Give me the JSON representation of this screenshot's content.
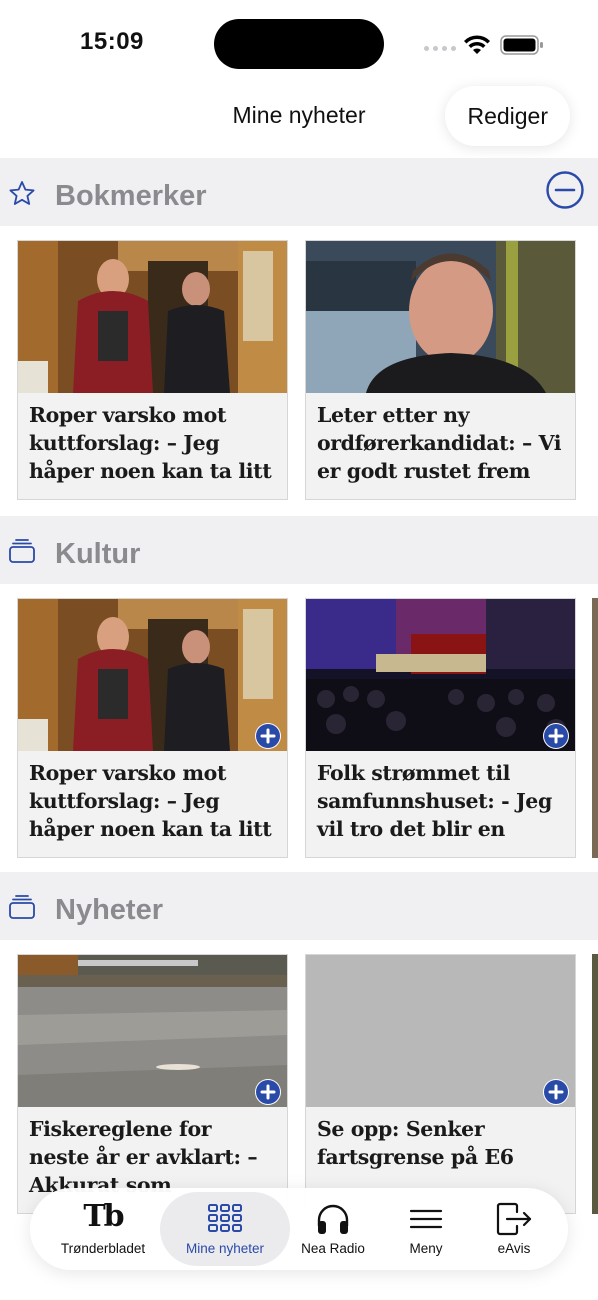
{
  "status_bar": {
    "time": "15:09"
  },
  "header": {
    "title": "Mine nyheter",
    "edit_label": "Rediger"
  },
  "sections": [
    {
      "title": "Bokmerker",
      "icon": "star-icon",
      "cards": [
        {
          "title": "Roper varsko mot kuttforslag: – Jeg håper noen kan ta litt",
          "image": "two-men-hallway-photo"
        },
        {
          "title": "Leter etter ny ordførerkandidat: – Vi er godt rustet frem",
          "image": "man-portrait-photo"
        }
      ]
    },
    {
      "title": "Kultur",
      "icon": "stack-icon",
      "cards": [
        {
          "title": "Roper varsko mot kuttforslag: – Jeg håper noen kan ta litt",
          "image": "two-men-hallway-photo"
        },
        {
          "title": "Folk strømmet til samfunnshuset: - Jeg vil tro det blir en",
          "image": "concert-hall-photo"
        }
      ]
    },
    {
      "title": "Nyheter",
      "icon": "stack-icon",
      "cards": [
        {
          "title": "Fiskereglene for neste år er avklart: – Akkurat som",
          "image": "river-photo"
        },
        {
          "title": "Se opp: Senker fartsgrense på E6",
          "image": "placeholder-grey"
        }
      ]
    }
  ],
  "tabbar": {
    "tabs": [
      {
        "label": "Trønderbladet",
        "icon": "tb-logo",
        "logo_text": "Tb"
      },
      {
        "label": "Mine nyheter",
        "icon": "grid-icon",
        "active": true
      },
      {
        "label": "Nea Radio",
        "icon": "headphones-icon"
      },
      {
        "label": "Meny",
        "icon": "hamburger-icon"
      },
      {
        "label": "eAvis",
        "icon": "exit-icon"
      }
    ]
  },
  "colors": {
    "accent": "#2a4aa8",
    "section_bg": "#f0f0f3",
    "section_title": "#8a8a8f"
  }
}
